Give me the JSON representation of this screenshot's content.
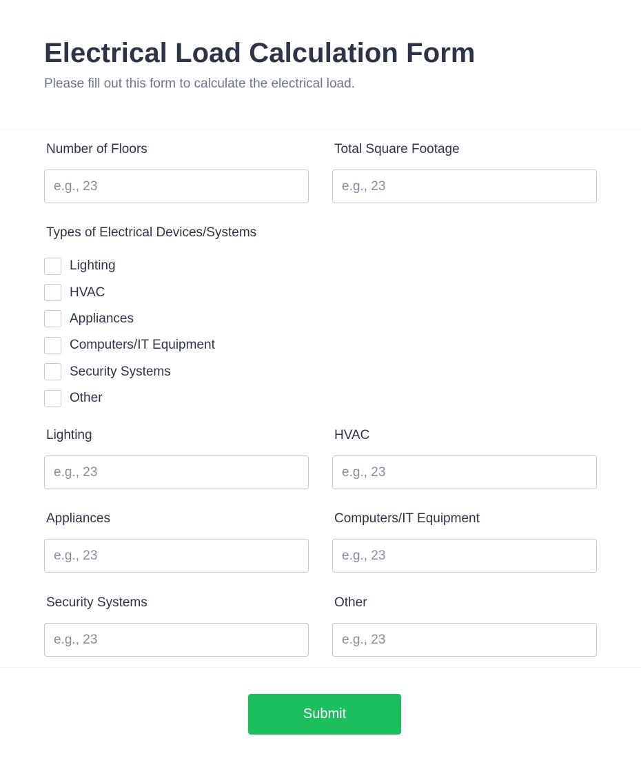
{
  "header": {
    "title": "Electrical Load Calculation Form",
    "subtitle": "Please fill out this form to calculate the electrical load."
  },
  "fields": {
    "floors": {
      "label": "Number of Floors",
      "placeholder": "e.g., 23",
      "value": ""
    },
    "square_footage": {
      "label": "Total Square Footage",
      "placeholder": "e.g., 23",
      "value": ""
    },
    "lighting": {
      "label": "Lighting",
      "placeholder": "e.g., 23",
      "value": ""
    },
    "hvac": {
      "label": "HVAC",
      "placeholder": "e.g., 23",
      "value": ""
    },
    "appliances": {
      "label": "Appliances",
      "placeholder": "e.g., 23",
      "value": ""
    },
    "computers": {
      "label": "Computers/IT Equipment",
      "placeholder": "e.g., 23",
      "value": ""
    },
    "security": {
      "label": "Security Systems",
      "placeholder": "e.g., 23",
      "value": ""
    },
    "other": {
      "label": "Other",
      "placeholder": "e.g., 23",
      "value": ""
    }
  },
  "device_types": {
    "label": "Types of Electrical Devices/Systems",
    "options": [
      {
        "label": "Lighting",
        "checked": false
      },
      {
        "label": "HVAC",
        "checked": false
      },
      {
        "label": "Appliances",
        "checked": false
      },
      {
        "label": "Computers/IT Equipment",
        "checked": false
      },
      {
        "label": "Security Systems",
        "checked": false
      },
      {
        "label": "Other",
        "checked": false
      }
    ]
  },
  "actions": {
    "submit_label": "Submit"
  },
  "colors": {
    "accent": "#1bbf5e",
    "title": "#2c3446",
    "subtitle": "#6c7589",
    "border": "#c3c7d1",
    "placeholder": "#858c9c"
  }
}
